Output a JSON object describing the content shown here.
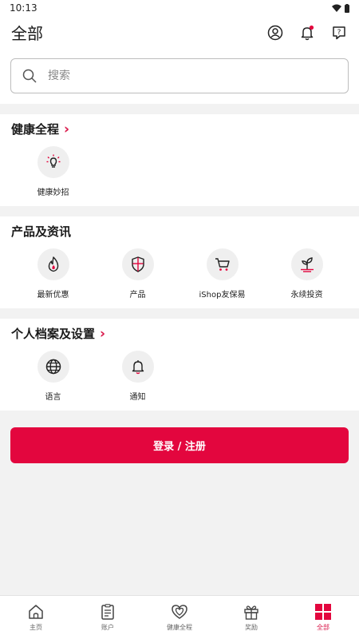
{
  "status": {
    "time": "10:13"
  },
  "header": {
    "title": "全部"
  },
  "search": {
    "placeholder": "搜索"
  },
  "sections": {
    "health": {
      "title": "健康全程",
      "items": [
        {
          "label": "健康妙招",
          "icon": "lightbulb-icon"
        }
      ]
    },
    "products": {
      "title": "产品及资讯",
      "items": [
        {
          "label": "最新优惠",
          "icon": "flame-icon"
        },
        {
          "label": "产品",
          "icon": "shield-icon"
        },
        {
          "label": "iShop友保易",
          "icon": "cart-icon"
        },
        {
          "label": "永续投资",
          "icon": "sprout-icon"
        }
      ]
    },
    "settings": {
      "title": "个人档案及设置",
      "items": [
        {
          "label": "语言",
          "icon": "globe-icon"
        },
        {
          "label": "通知",
          "icon": "bell-icon"
        }
      ]
    }
  },
  "login": {
    "label": "登录 / 注册"
  },
  "nav": {
    "items": [
      {
        "label": "主页",
        "icon": "home-icon"
      },
      {
        "label": "账户",
        "icon": "document-icon"
      },
      {
        "label": "健康全程",
        "icon": "heart-icon"
      },
      {
        "label": "奖励",
        "icon": "gift-icon"
      },
      {
        "label": "全部",
        "icon": "grid-icon",
        "active": true
      }
    ]
  },
  "colors": {
    "accent": "#e3063e",
    "background": "#f2f2f2"
  }
}
